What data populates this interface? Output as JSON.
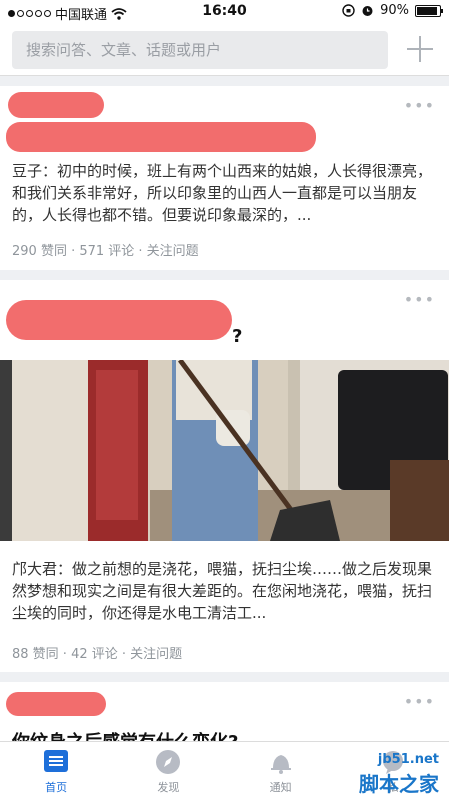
{
  "status_bar": {
    "carrier": "中国联通",
    "time": "16:40",
    "battery": "90%",
    "battery_level": 0.9
  },
  "search": {
    "placeholder": "搜索问答、文章、话题或用户"
  },
  "cards": [
    {
      "more": "•••",
      "excerpt": "豆子：初中的时候，班上有两个山西来的姑娘，人长得很漂亮，和我们关系非常好，所以印象里的山西人一直都是可以当朋友的，人长得也都不错。但要说印象最深的，...",
      "meta": "290 赞同 · 571 评论 · 关注问题"
    },
    {
      "more": "•••",
      "title_visible": "?",
      "excerpt": "邝大君：做之前想的是浇花，喂猫，抚扫尘埃……做之后发现果然梦想和现实之间是有很大差距的。在您闲地浇花，喂猫，抚扫尘埃的同时，你还得是水电工清洁工...",
      "meta": "88 赞同 · 42 评论 · 关注问题"
    },
    {
      "more": "•••",
      "title": "你纹身之后感觉有什么变化?"
    }
  ],
  "tabs": [
    {
      "label": "首页",
      "icon": "home-icon",
      "active": true
    },
    {
      "label": "发现",
      "icon": "compass-icon",
      "active": false
    },
    {
      "label": "通知",
      "icon": "bell-icon",
      "active": false
    },
    {
      "label": "私",
      "icon": "chat-icon",
      "active": false
    }
  ],
  "watermark": {
    "site": "jb51.net",
    "name": "脚本之家"
  },
  "colors": {
    "accent": "#1e6fd9",
    "redaction": "#f26d6d",
    "meta_gray": "#8f959b"
  }
}
